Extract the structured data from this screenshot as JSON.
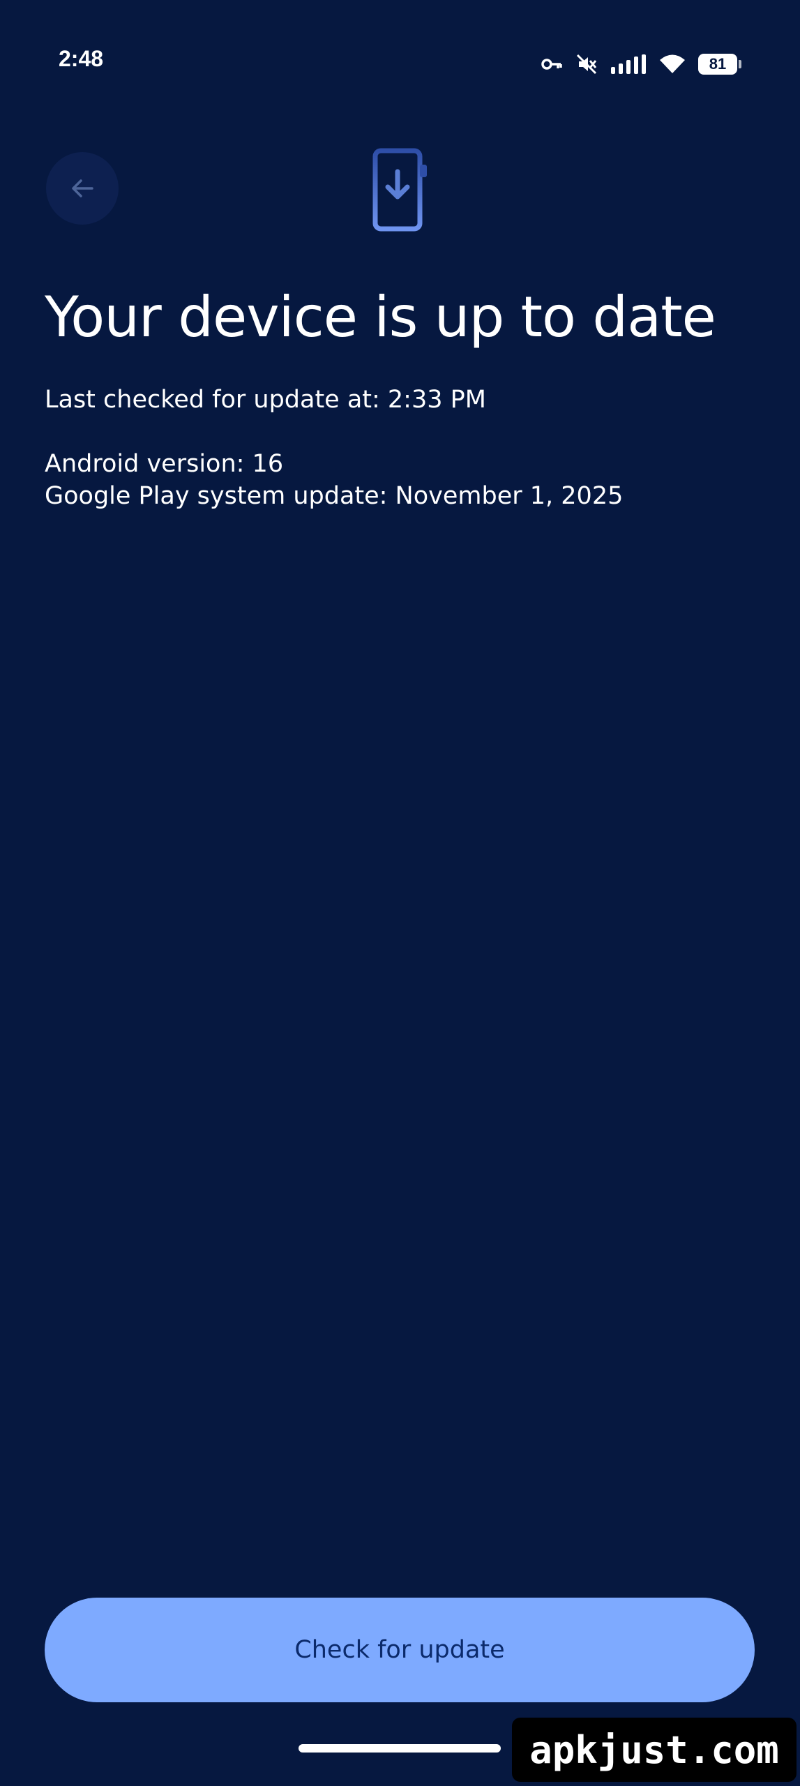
{
  "status_bar": {
    "time": "2:48",
    "battery_level": "81",
    "icons": [
      "vpn-key-icon",
      "mute-icon",
      "signal-icon",
      "wifi-icon",
      "battery-icon"
    ]
  },
  "top_bar": {
    "back_icon": "arrow-back-icon",
    "hero_icon": "system-update-icon"
  },
  "content": {
    "title": "Your device is up to date",
    "last_checked": "Last checked for update at: 2:33 PM",
    "android_version": "Android version: 16",
    "gplay_update": "Google Play system update: November 1, 2025"
  },
  "actions": {
    "check_button_label": "Check for update"
  },
  "watermark": {
    "text": "apkjust.com"
  },
  "colors": {
    "background": "#061840",
    "button": "#7eaaff",
    "button_text": "#0b2a6b",
    "icon_accent": "#5b7fd6"
  }
}
